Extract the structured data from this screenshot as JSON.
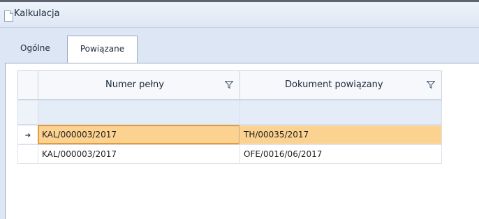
{
  "window": {
    "title": "Kalkulacja",
    "icon": "document-icon"
  },
  "tabs": [
    {
      "label": "Ogólne",
      "active": false
    },
    {
      "label": "Powiązane",
      "active": true
    }
  ],
  "grid": {
    "columns": [
      {
        "header": "Numer pełny",
        "filter_icon": "funnel-icon"
      },
      {
        "header": "Dokument powiązany",
        "filter_icon": "funnel-icon"
      }
    ],
    "rows": [
      {
        "indicator": "➔",
        "cells": [
          "KAL/000003/2017",
          "TH/00035/2017"
        ],
        "selected": true
      },
      {
        "indicator": "",
        "cells": [
          "KAL/000003/2017",
          "OFE/0016/06/2017"
        ],
        "selected": false
      }
    ]
  },
  "colors": {
    "selected_row": "#fcd290",
    "focused_cell_border": "#e39b3e",
    "filter_row": "#e3ecf7",
    "window_bg": "#dce6f4"
  }
}
